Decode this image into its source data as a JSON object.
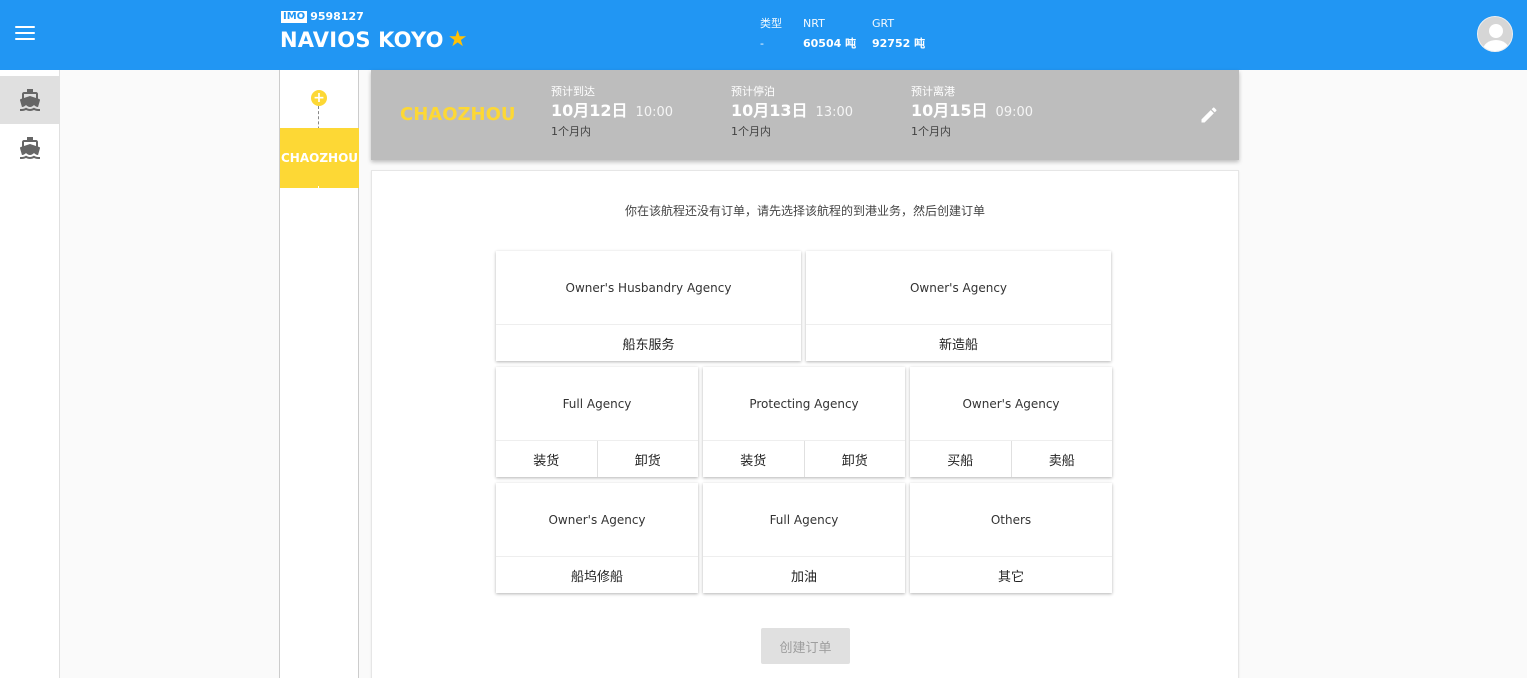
{
  "header": {
    "imo_label": "IMO",
    "imo_number": "9598127",
    "ship_name": "NAVIOS KOYO",
    "stats": [
      {
        "label": "类型",
        "value": "-"
      },
      {
        "label": "NRT",
        "value": "60504 吨"
      },
      {
        "label": "GRT",
        "value": "92752 吨"
      }
    ],
    "colors": {
      "bar": "#2196f3",
      "star": "#ffc107"
    }
  },
  "timeline": {
    "add_symbol": "+",
    "port_tab": "CHAOZHOU"
  },
  "port": {
    "name": "CHAOZHOU",
    "times": [
      {
        "label": "预计到达",
        "date": "10月12日",
        "time": "10:00",
        "range": "1个月内"
      },
      {
        "label": "预计停泊",
        "date": "10月13日",
        "time": "13:00",
        "range": "1个月内"
      },
      {
        "label": "预计离港",
        "date": "10月15日",
        "time": "09:00",
        "range": "1个月内"
      }
    ]
  },
  "main": {
    "prompt": "你在该航程还没有订单，请先选择该航程的到港业务，然后创建订单",
    "services": [
      {
        "title": "Owner's Husbandry Agency",
        "options": [
          "船东服务"
        ]
      },
      {
        "title": "Owner's Agency",
        "options": [
          "新造船"
        ]
      },
      {
        "title": "Full Agency",
        "options": [
          "装货",
          "卸货"
        ]
      },
      {
        "title": "Protecting Agency",
        "options": [
          "装货",
          "卸货"
        ]
      },
      {
        "title": "Owner's Agency",
        "options": [
          "买船",
          "卖船"
        ]
      },
      {
        "title": "Owner's Agency",
        "options": [
          "船坞修船"
        ]
      },
      {
        "title": "Full Agency",
        "options": [
          "加油"
        ]
      },
      {
        "title": "Others",
        "options": [
          "其它"
        ]
      }
    ],
    "create_button": "创建订单"
  },
  "icons": [
    "menu-icon",
    "star-icon",
    "avatar-icon",
    "ship-icon",
    "edit-icon"
  ]
}
